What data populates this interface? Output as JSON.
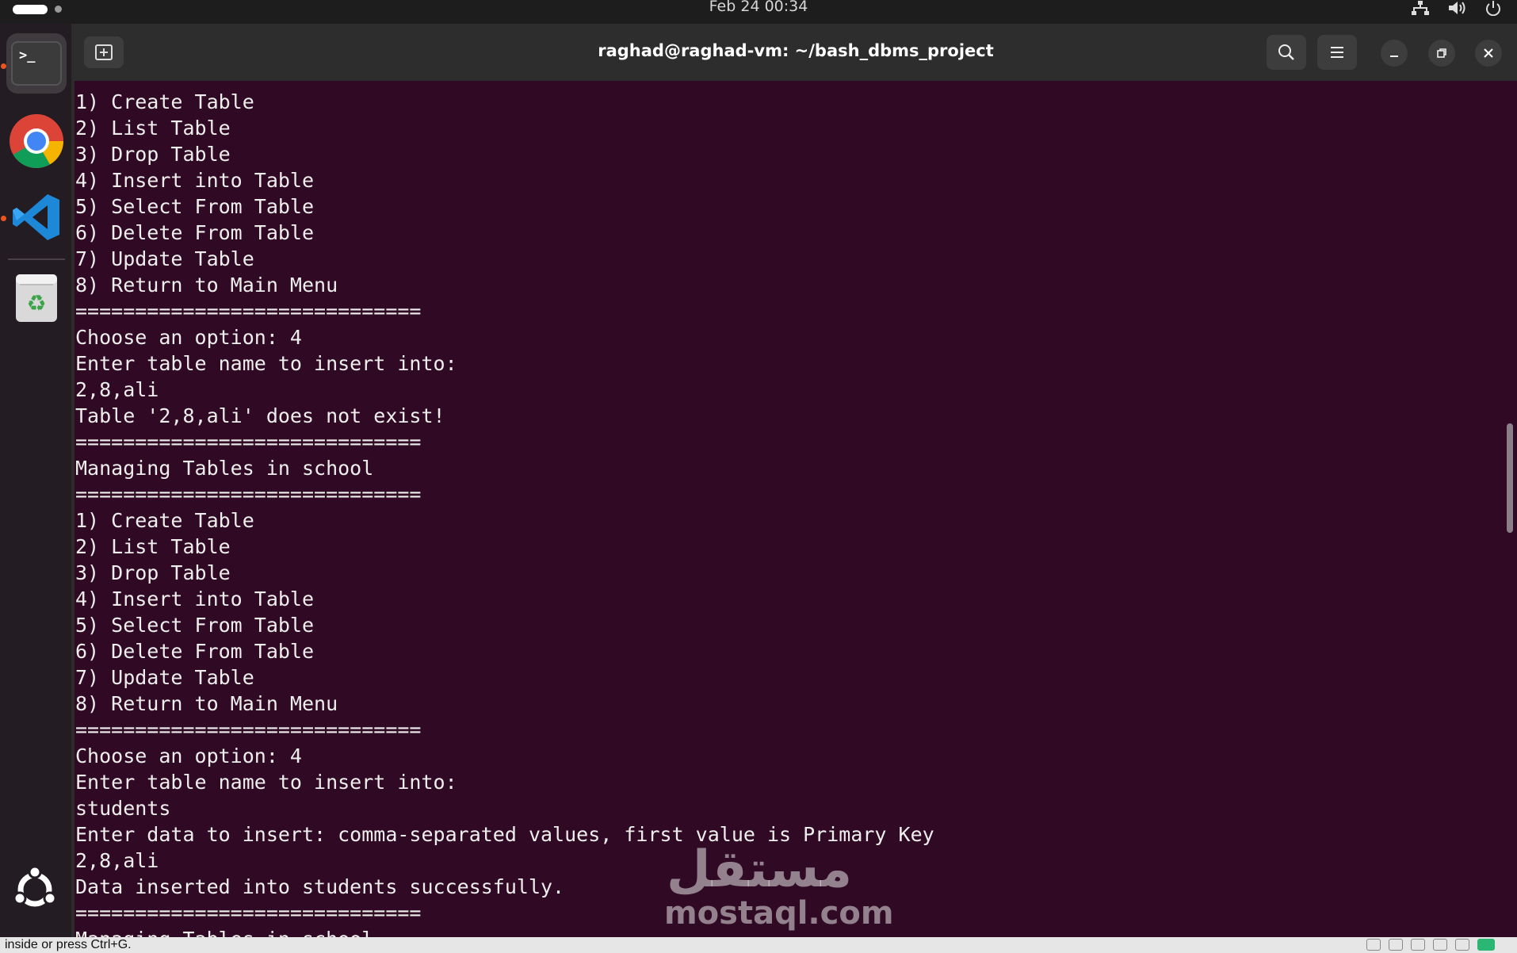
{
  "topbar": {
    "clock": "Feb 24  00:34",
    "tray_icons": [
      "network-icon",
      "volume-icon",
      "power-icon"
    ]
  },
  "dock": {
    "items": [
      {
        "name": "terminal",
        "label": ">_",
        "active": true
      },
      {
        "name": "chrome",
        "active": false
      },
      {
        "name": "vscode",
        "active": true
      },
      {
        "name": "trash",
        "active": false
      }
    ],
    "accent": "#e95420"
  },
  "window": {
    "title": "raghad@raghad-vm: ~/bash_dbms_project",
    "background": "#300a24"
  },
  "terminal": {
    "lines": [
      "1) Create Table",
      "2) List Table",
      "3) Drop Table",
      "4) Insert into Table",
      "5) Select From Table",
      "6) Delete From Table",
      "7) Update Table",
      "8) Return to Main Menu",
      "=============================",
      "Choose an option: 4",
      "Enter table name to insert into:",
      "2,8,ali",
      "Table '2,8,ali' does not exist!",
      "=============================",
      "Managing Tables in school",
      "=============================",
      "1) Create Table",
      "2) List Table",
      "3) Drop Table",
      "4) Insert into Table",
      "5) Select From Table",
      "6) Delete From Table",
      "7) Update Table",
      "8) Return to Main Menu",
      "=============================",
      "Choose an option: 4",
      "Enter table name to insert into:",
      "students",
      "Enter data to insert: comma-separated values, first value is Primary Key",
      "2,8,ali",
      "Data inserted into students successfully.",
      "=============================",
      "Managing Tables in school"
    ]
  },
  "watermark": {
    "arabic": "مستقل",
    "latin": "mostaql.com"
  },
  "statusbar": {
    "text": "inside or press Ctrl+G."
  }
}
